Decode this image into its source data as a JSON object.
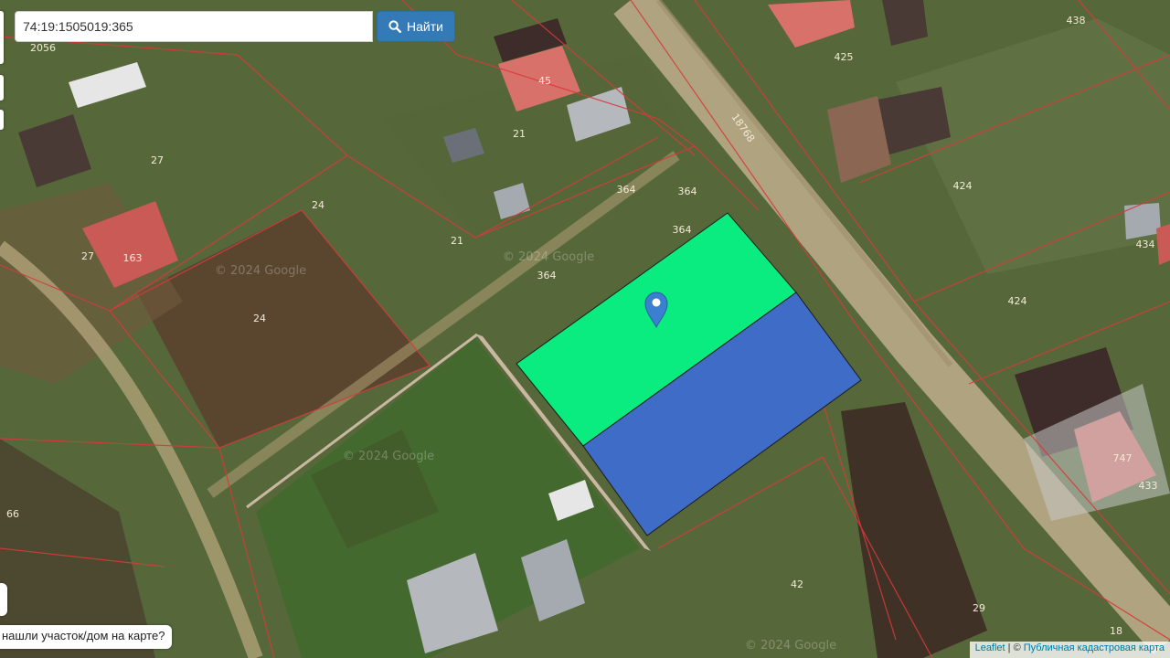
{
  "search": {
    "value": "74:19:1505019:365",
    "button_label": "Найти",
    "button_icon": "search-icon"
  },
  "feedback": {
    "text": "нашли участок/дом на карте?"
  },
  "attribution": {
    "leaflet": "Leaflet",
    "separator": " | © ",
    "provider": "Публичная кадастровая карта"
  },
  "map": {
    "selected_parcel_color": "#0aec7f",
    "adjacent_parcel_color": "#3f6cc6",
    "boundary_color": "#d63a3a",
    "marker_color": "#3a7fd0",
    "parcel_labels": [
      "2056",
      "45",
      "21",
      "27",
      "24",
      "27",
      "163",
      "364",
      "364",
      "364",
      "364",
      "21",
      "24",
      "18768",
      "425",
      "424",
      "438",
      "434",
      "424",
      "747",
      "433",
      "66",
      "42",
      "29",
      "18"
    ],
    "watermarks": [
      "© 2024 Google",
      "© 2024 Google",
      "© 2024 Google",
      "© 2024 Google"
    ]
  }
}
